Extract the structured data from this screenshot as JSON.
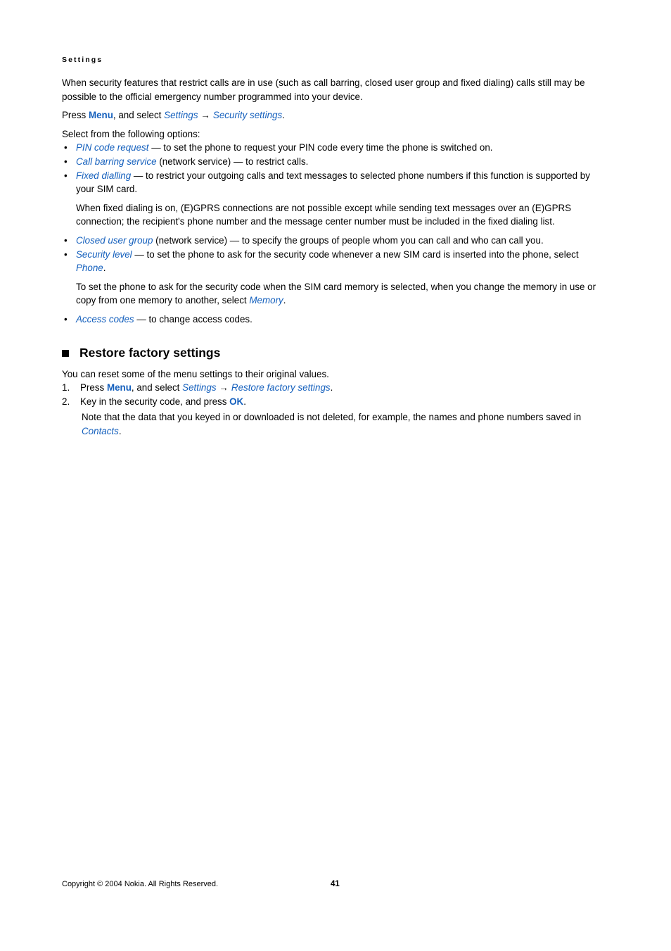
{
  "page": {
    "running_head": "Settings",
    "page_number": "41",
    "copyright": "Copyright © 2004 Nokia. All Rights Reserved.",
    "accent_color": "#1560bd",
    "text_color": "#000000",
    "background_color": "#ffffff"
  },
  "intro": {
    "paragraph": "When security features that restrict calls are in use (such as call barring, closed user group and fixed dialing) calls still may be possible to the official emergency number programmed into your device.",
    "press_prefix": "Press ",
    "press_menu": "Menu",
    "press_mid": ", and select ",
    "path_1": "Settings",
    "path_arrow": "→",
    "path_2": "Security settings",
    "press_suffix": ".",
    "select_options_line": "Select from the following options:"
  },
  "options": [
    {
      "term": "PIN code request",
      "rest": " — to set the phone to request your PIN code every time the phone is switched on."
    },
    {
      "term": "Call barring service",
      "rest": " (network service) — to restrict calls."
    },
    {
      "term": "Fixed dialling",
      "rest": " — to restrict your outgoing calls and text messages to selected phone numbers if this function is supported by your SIM card."
    },
    {
      "term": "Closed user group",
      "rest": " (network service) — to specify the groups of people whom you can call and who can call you."
    },
    {
      "term": "Security level",
      "rest_a": " — to set the phone to ask for the security code whenever a new SIM card is inserted into the phone, select ",
      "rest_term": "Phone",
      "rest_b": "."
    },
    {
      "term": "Access codes",
      "rest": " — to change access codes."
    }
  ],
  "notes": {
    "fixed_dialling_note": "When fixed dialing is on, (E)GPRS connections are not possible except while sending text messages over an (E)GPRS connection; the recipient's phone number and the message center number must be included in the fixed dialing list.",
    "security_level_note_a": "To set the phone to ask for the security code when the SIM card memory is selected, when you change the memory in use or copy from one memory to another, select ",
    "security_level_note_term": "Memory",
    "security_level_note_b": "."
  },
  "restore_section": {
    "heading": "Restore factory settings",
    "intro": "You can reset some of the menu settings to their original values.",
    "steps": [
      {
        "number": "1.",
        "prefix": "Press ",
        "bold": "Menu",
        "mid": ", and select ",
        "path_1": "Settings",
        "arrow": "→",
        "path_2": "Restore factory settings",
        "suffix": "."
      },
      {
        "number": "2.",
        "prefix": "Key in the security code, and press ",
        "bold": "OK",
        "mid": "",
        "path_1": "",
        "arrow": "",
        "path_2": "",
        "suffix": "."
      }
    ],
    "note_a": "Note that the data that you keyed in or downloaded is not deleted, for example, the names and phone numbers saved in ",
    "note_term": "Contacts",
    "note_b": "."
  },
  "glyphs": {
    "bullet": "•",
    "arrow": "→",
    "square": "■"
  }
}
